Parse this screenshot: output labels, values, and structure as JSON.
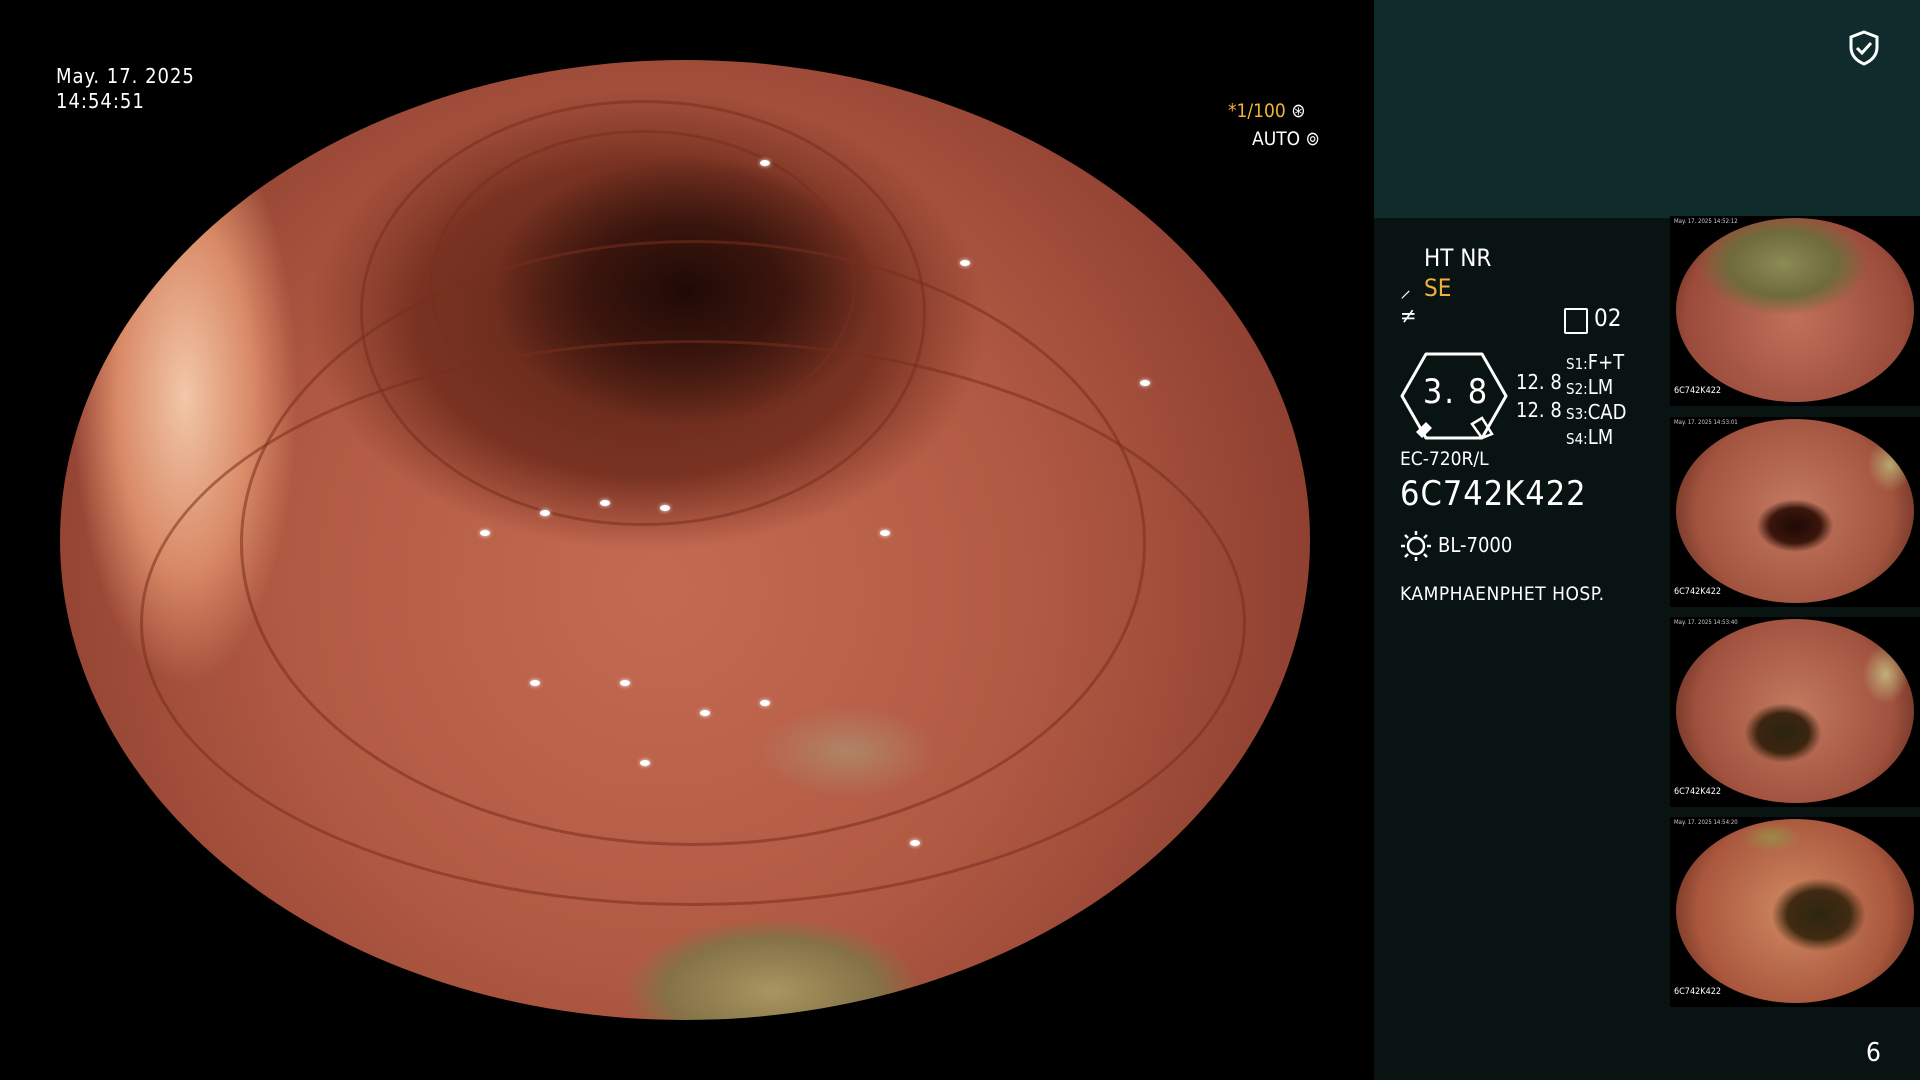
{
  "overlay": {
    "date": "May. 17. 2025",
    "time": "14:54:51",
    "shutter": "*1/100",
    "shutter_icon": "aperture-icon",
    "exposure_mode": "AUTO",
    "exposure_icon": "iris-icon"
  },
  "panel": {
    "shield_icon": "shield-check-icon",
    "ht_nr": "HT NR",
    "se_label": "SE",
    "mode_value": "02",
    "gauge_value": "3. 8",
    "values": [
      "12. 8",
      "12. 8"
    ],
    "switches": [
      {
        "label": "S1",
        "value": "F+T"
      },
      {
        "label": "S2",
        "value": "LM"
      },
      {
        "label": "S3",
        "value": "CAD"
      },
      {
        "label": "S4",
        "value": "LM"
      }
    ],
    "scope_model": "EC-720R/L",
    "scope_serial": "6C742K422",
    "light_source": "BL-7000",
    "hospital": "KAMPHAENPHET HOSP.",
    "page_number": "6",
    "accent_color": "#f0b23a",
    "panel_bg_top": "#0f2b2b",
    "panel_bg": "#081312"
  },
  "thumbnails": [
    {
      "serial": "6C742K422",
      "time": "May. 17. 2025 14:52:12"
    },
    {
      "serial": "6C742K422",
      "time": "May. 17. 2025 14:53:01"
    },
    {
      "serial": "6C742K422",
      "time": "May. 17. 2025 14:53:40"
    },
    {
      "serial": "6C742K422",
      "time": "May. 17. 2025 14:54:20"
    }
  ]
}
